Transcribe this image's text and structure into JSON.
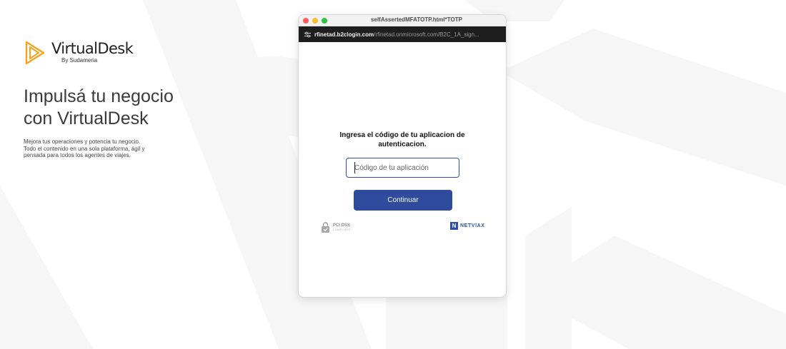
{
  "brand": {
    "name": "VirtualDesk",
    "sub": "By Sudameria",
    "logo_color": "#f7a21b"
  },
  "marketing": {
    "headline_line1": "Impulsá tu negocio",
    "headline_line2": "con VirtualDesk",
    "body_line1": "Mejora tus operaciones y potencia tu negocio.",
    "body_line2": "Todo el contenido en una sola plataforma, ágil y",
    "body_line3": "pensada para todos los agentes de viajes."
  },
  "window": {
    "title": "selfAssertedMFATOTP.html*TOTP",
    "url_host": "rfinetad.b2clogin.com",
    "url_path": "/rfinetad.onmicrosoft.com/B2C_1A_sign..."
  },
  "form": {
    "prompt_line1": "Ingresa el código de tu aplicacion de",
    "prompt_line2": "autenticacion.",
    "code_placeholder": "Código de tu aplicación",
    "code_value": "",
    "continue_label": "Continuar"
  },
  "footer": {
    "pci_label": "PCI DSS",
    "pci_sub": "COMPLIANT",
    "netviax_mark": "N",
    "netviax_label": "NETVIAX"
  },
  "colors": {
    "accent": "#2e4b9e",
    "input_border": "#2f4fa0",
    "bg_shape": "#f5f5f5"
  },
  "icons": {
    "logo": "virtualdesk-play-logo-icon",
    "window_close": "close-dot-icon",
    "window_minimize": "minimize-dot-icon",
    "window_zoom": "zoom-dot-icon",
    "site_settings": "tune-icon",
    "pci": "padlock-shield-icon",
    "netviax": "netviax-logo-icon"
  }
}
